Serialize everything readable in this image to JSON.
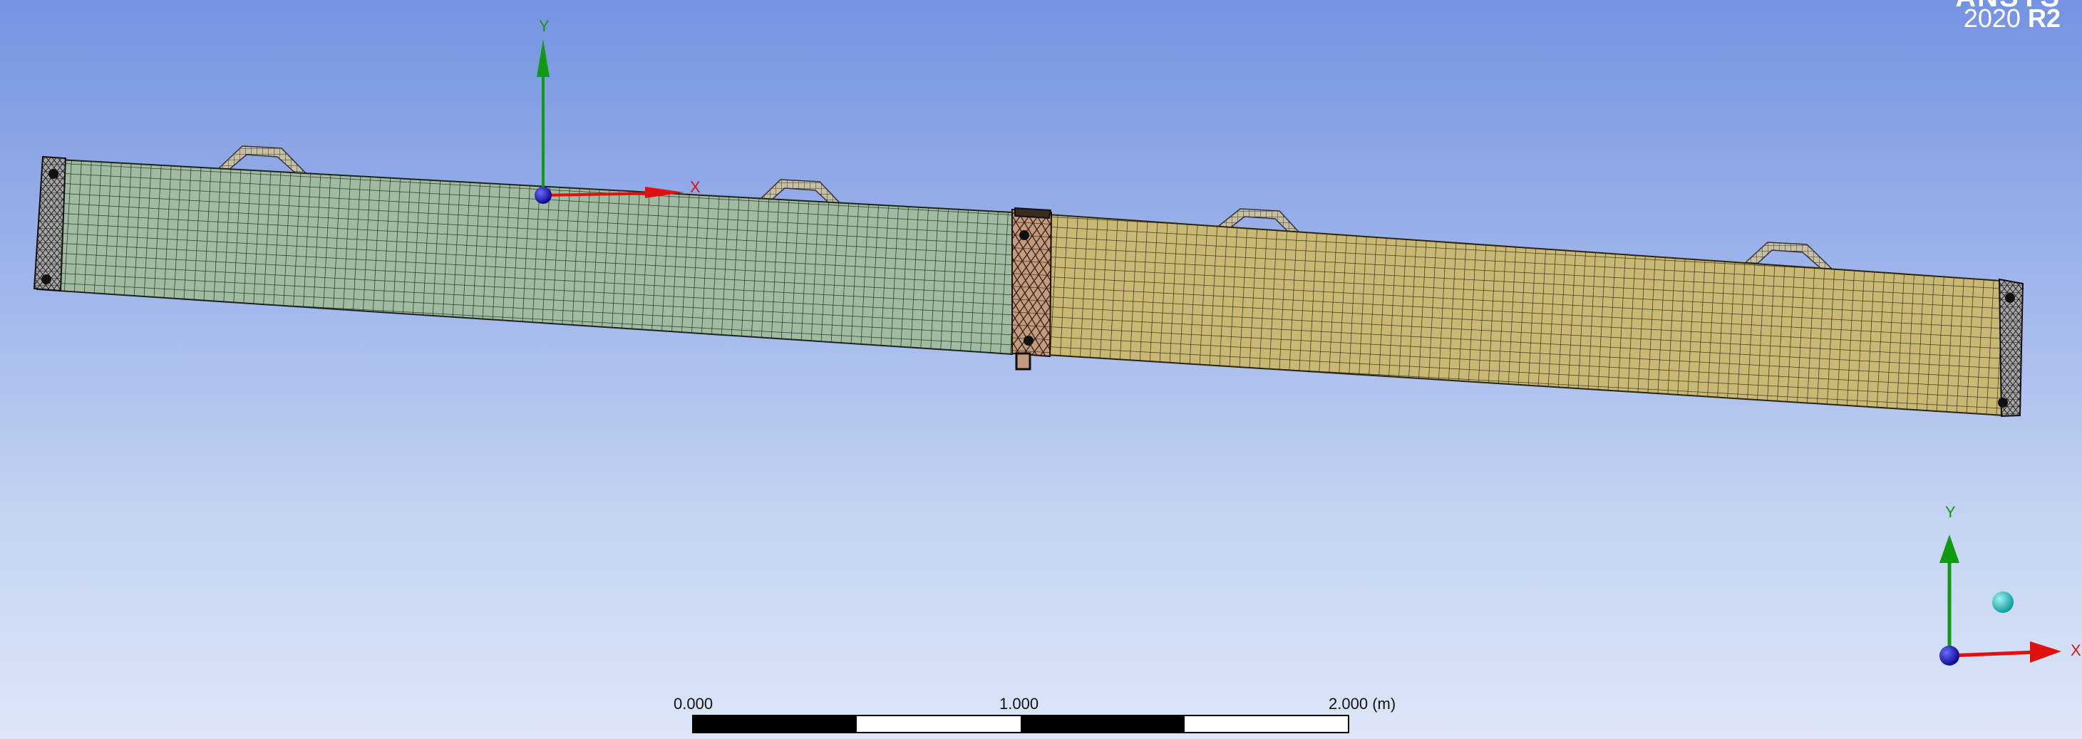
{
  "brand": {
    "name": "ANSYS",
    "version_year": "2020",
    "version_release": "R2"
  },
  "model_axes": {
    "x_label": "X",
    "y_label": "Y"
  },
  "triad": {
    "x_label": "X",
    "y_label": "Y"
  },
  "scale_bar": {
    "labels": [
      "0.000",
      "1.000",
      "2.000"
    ],
    "unit": "(m)"
  },
  "colors": {
    "left_body": "#9fbba0",
    "right_body": "#c9b873",
    "joint": "#c49b7d",
    "end_plate": "#a6a6a6",
    "lifting_lug": "#c8bfa3",
    "mesh_line": "#1c241c",
    "axis_x": "#e01010",
    "axis_y": "#109a10",
    "axis_z": "#1010c0",
    "triad_ball": "#19c6c6"
  }
}
